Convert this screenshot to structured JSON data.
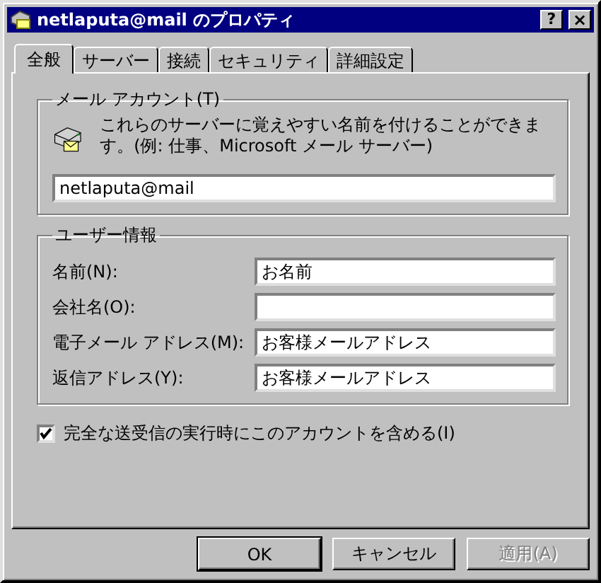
{
  "window": {
    "title": "netlaputa@mail のプロパティ"
  },
  "title_buttons": [
    {
      "kind": "help",
      "label": "?"
    },
    {
      "kind": "close",
      "label": "×"
    }
  ],
  "tabs": [
    {
      "label": "全般",
      "selected": true
    },
    {
      "label": "サーバー",
      "selected": false
    },
    {
      "label": "接続",
      "selected": false
    },
    {
      "label": "セキュリティ",
      "selected": false
    },
    {
      "label": "詳細設定",
      "selected": false
    }
  ],
  "mail_account": {
    "legend": "メール アカウント(T)",
    "description": "これらのサーバーに覚えやすい名前を付けることができます。(例: 仕事、Microsoft メール サーバー)",
    "value": "netlaputa@mail"
  },
  "user_info": {
    "legend": "ユーザー情報",
    "fields": [
      {
        "label": "名前(N):",
        "value": "お名前"
      },
      {
        "label": "会社名(O):"
      },
      {
        "label": "電子メール アドレス(M):",
        "value": "お客様メールアドレス"
      },
      {
        "label": "返信アドレス(Y):",
        "value": "お客様メールアドレス"
      }
    ]
  },
  "include_account": {
    "label": "完全な送受信の実行時にこのアカウントを含める(I)",
    "checked": true
  },
  "buttons": [
    {
      "label": "OK",
      "disabled": false,
      "default": true
    },
    {
      "label": "キャンセル",
      "disabled": false,
      "default": false
    },
    {
      "label": "適用(A)",
      "disabled": true,
      "default": false
    }
  ]
}
